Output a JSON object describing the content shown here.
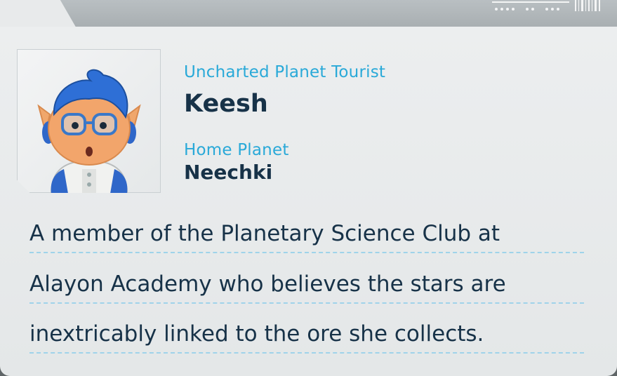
{
  "profile": {
    "title_label": "Uncharted Planet Tourist",
    "name": "Keesh",
    "home_label": "Home Planet",
    "home_value": "Neechki"
  },
  "description": {
    "lines": [
      "A member of the Planetary Science Club at",
      "Alayon Academy who believes the stars are",
      "inextricably linked to the ore she collects."
    ]
  },
  "colors": {
    "label_blue": "#29a9d8",
    "text_navy": "#173248",
    "underline": "#9fd3ea"
  },
  "icons": {
    "portrait": "alien-character-portrait"
  }
}
